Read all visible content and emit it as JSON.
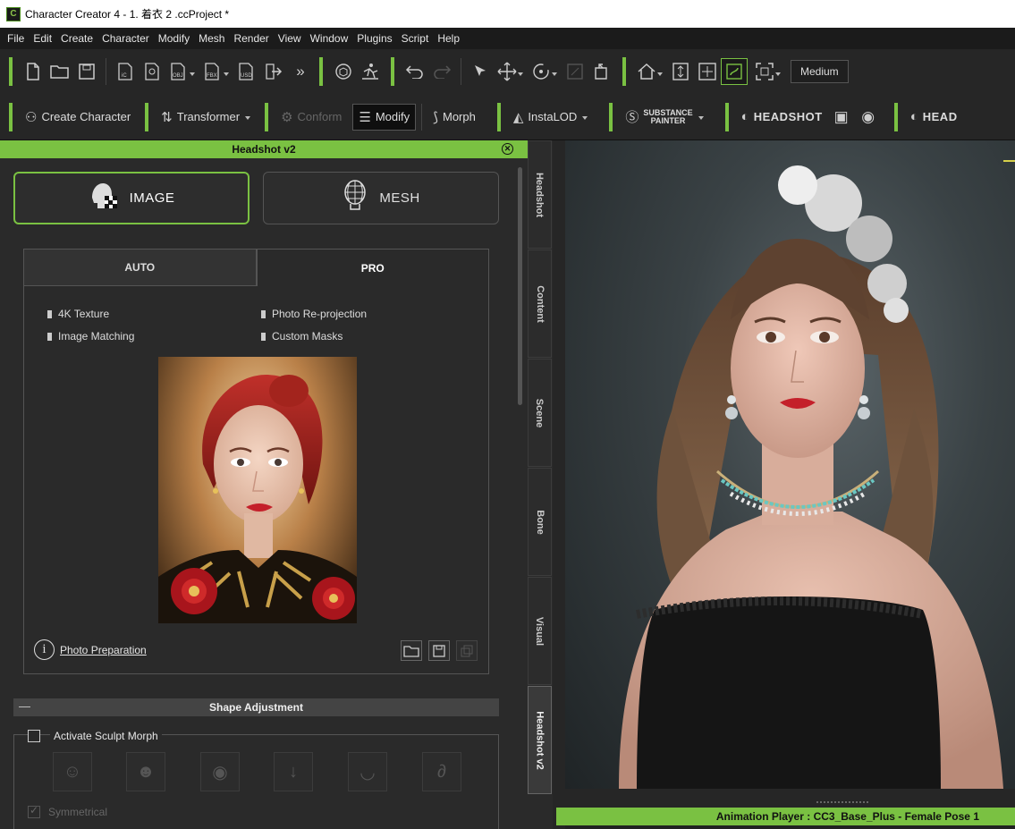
{
  "window": {
    "title": "Character Creator 4 - 1. 着衣 2 .ccProject *",
    "app_icon": "cc-app-icon"
  },
  "menu": [
    "File",
    "Edit",
    "Create",
    "Character",
    "Modify",
    "Mesh",
    "Render",
    "View",
    "Window",
    "Plugins",
    "Script",
    "Help"
  ],
  "toolbar_main": {
    "quality_label": "Medium"
  },
  "toolbar_plugins": {
    "create_character": "Create Character",
    "transformer": "Transformer",
    "conform": "Conform",
    "modify": "Modify",
    "morph": "Morph",
    "instalod": "InstaLOD",
    "substance_line1": "SUBSTANCE",
    "substance_line2": "PAINTER",
    "headshot": "HEADSHOT",
    "headshot_cut": "HEAD"
  },
  "panel": {
    "title": "Headshot v2",
    "mode_image": "IMAGE",
    "mode_mesh": "MESH",
    "tab_auto": "AUTO",
    "tab_pro": "PRO",
    "features": [
      "4K Texture",
      "Photo Re-projection",
      "Image Matching",
      "Custom Masks"
    ],
    "photo_prep_label": "Photo Preparation",
    "shape_section": "Shape Adjustment",
    "activate_sculpt": "Activate Sculpt Morph",
    "symmetrical": "Symmetrical"
  },
  "side_tabs": [
    "Headshot",
    "Content",
    "Scene",
    "Bone",
    "Visual",
    "Headshot v2"
  ],
  "animation_player": "Animation Player : CC3_Base_Plus - Female Pose 1",
  "colors": {
    "accent": "#7ac142",
    "panel_bg": "#2a2a2a",
    "toolbar_bg": "#262626"
  }
}
